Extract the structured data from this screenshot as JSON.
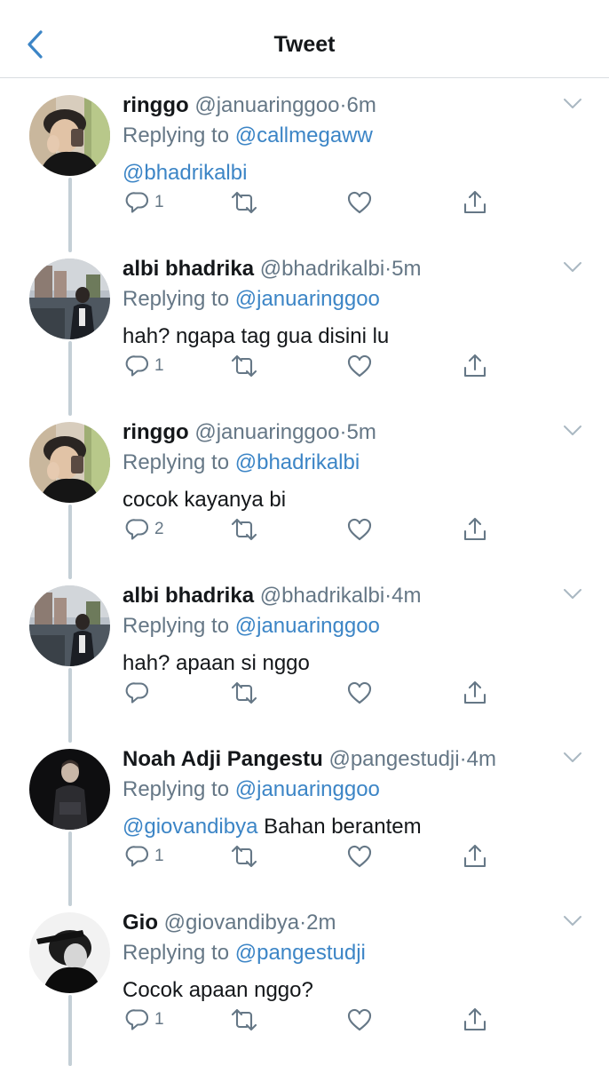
{
  "header": {
    "title": "Tweet"
  },
  "labels": {
    "replying_to": "Replying to"
  },
  "colors": {
    "accent": "#3c85c6",
    "secondary_text": "#657786",
    "thread_line": "#c4cfd6"
  },
  "tweets": [
    {
      "name": "ringgo",
      "handle": "@januaringgoo",
      "time": "6m",
      "replying_to": "@callmegaww",
      "text_mention": "@bhadrikalbi",
      "text": "",
      "reply_count": "1",
      "avatar": "ringgo-avatar"
    },
    {
      "name": "albi bhadrika",
      "handle": "@bhadrikalbi",
      "time": "5m",
      "replying_to": "@januaringgoo",
      "text_mention": "",
      "text": "hah? ngapa tag gua disini lu",
      "reply_count": "1",
      "avatar": "albi-avatar"
    },
    {
      "name": "ringgo",
      "handle": "@januaringgoo",
      "time": "5m",
      "replying_to": "@bhadrikalbi",
      "text_mention": "",
      "text": "cocok kayanya bi",
      "reply_count": "2",
      "avatar": "ringgo-avatar"
    },
    {
      "name": "albi bhadrika",
      "handle": "@bhadrikalbi",
      "time": "4m",
      "replying_to": "@januaringgoo",
      "text_mention": "",
      "text": "hah? apaan si nggo",
      "reply_count": "",
      "avatar": "albi-avatar"
    },
    {
      "name": "Noah Adji Pangestu",
      "handle": "@pangestudji",
      "time": "4m",
      "replying_to": "@januaringgoo",
      "text_mention": "@giovandibya",
      "text": " Bahan berantem",
      "reply_count": "1",
      "avatar": "noah-avatar"
    },
    {
      "name": "Gio",
      "handle": "@giovandibya",
      "time": "2m",
      "replying_to": "@pangestudji",
      "text_mention": "",
      "text": "Cocok apaan nggo?",
      "reply_count": "1",
      "avatar": "gio-avatar"
    }
  ]
}
